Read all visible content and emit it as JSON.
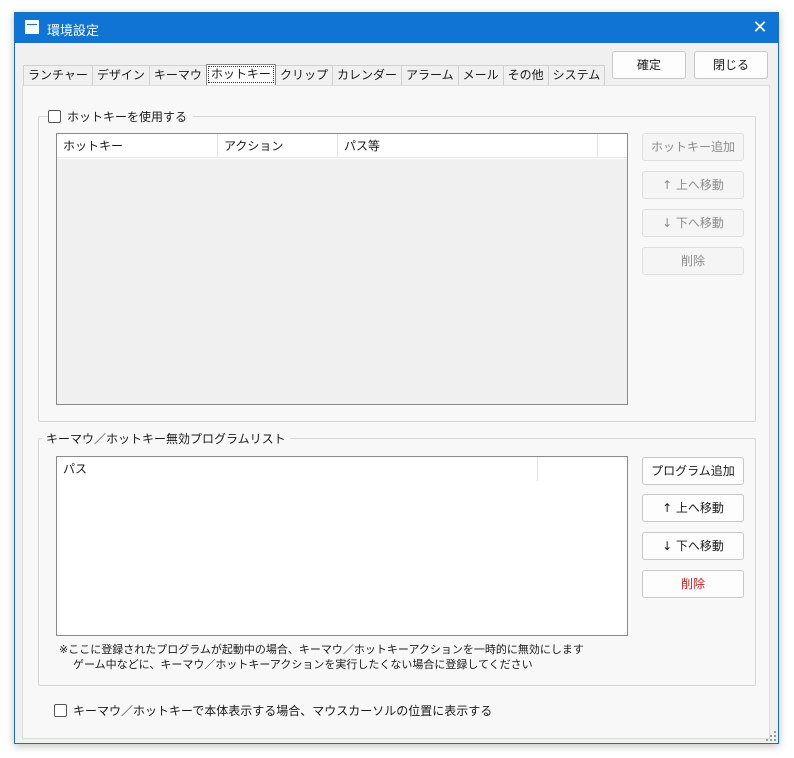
{
  "window": {
    "title": "環境設定",
    "close_glyph": "✕"
  },
  "tabs": [
    {
      "label": "ランチャー"
    },
    {
      "label": "デザイン"
    },
    {
      "label": "キーマウ"
    },
    {
      "label": "ホットキー",
      "active": true
    },
    {
      "label": "クリップ"
    },
    {
      "label": "カレンダー"
    },
    {
      "label": "アラーム"
    },
    {
      "label": "メール"
    },
    {
      "label": "その他"
    },
    {
      "label": "システム"
    }
  ],
  "top_buttons": {
    "ok": "確定",
    "close": "閉じる"
  },
  "hotkey_group": {
    "checkbox_label": "ホットキーを使用する",
    "checked": false,
    "columns": [
      "ホットキー",
      "アクション",
      "パス等"
    ],
    "buttons": {
      "add": "ホットキー追加",
      "up": "↑ 上へ移動",
      "down": "↓ 下へ移動",
      "delete": "削除"
    }
  },
  "program_group": {
    "title": "キーマウ／ホットキー無効プログラムリスト",
    "columns": [
      "パス"
    ],
    "buttons": {
      "add": "プログラム追加",
      "up": "↑ 上へ移動",
      "down": "↓ 下へ移動",
      "delete": "削除"
    },
    "note_line1": "※ここに登録されたプログラムが起動中の場合、キーマウ／ホットキーアクションを一時的に無効にします",
    "note_line2": "ゲーム中などに、キーマウ／ホットキーアクションを実行したくない場合に登録してください"
  },
  "bottom_checkbox": {
    "label": "キーマウ／ホットキーで本体表示する場合、マウスカーソルの位置に表示する",
    "checked": false
  },
  "colors": {
    "titlebar": "#0f74d3",
    "danger": "#c81e1e",
    "disabled_text": "#8c8c8c"
  }
}
